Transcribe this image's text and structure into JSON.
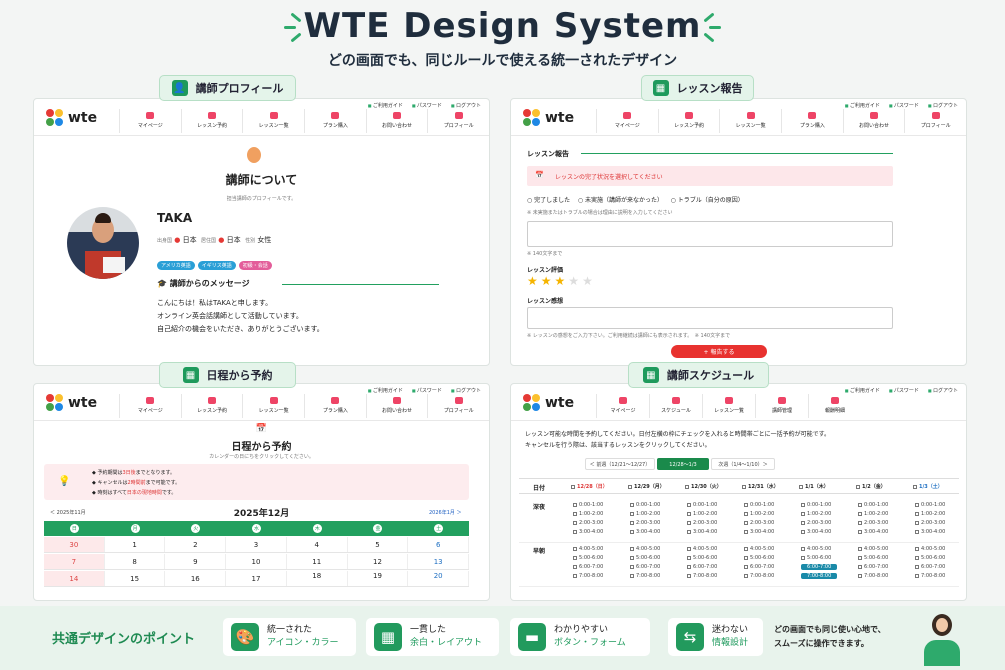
{
  "hero": {
    "title": "WTE Design System",
    "subtitle": "どの画面でも、同じルールで使える統一されたデザイン"
  },
  "sections": {
    "profile": "講師プロフィール",
    "report": "レッスン報告",
    "booking": "日程から予約",
    "schedule": "講師スケジュール"
  },
  "header": {
    "logo": "wte",
    "toplinks": [
      "ご利用ガイド",
      "パスワード",
      "ログアウト"
    ],
    "nav": [
      "マイページ",
      "レッスン予約",
      "レッスン一覧",
      "プラン購入",
      "お問い合わせ",
      "プロフィール"
    ],
    "nav_teacher": [
      "マイページ",
      "スケジュール",
      "レッスン一覧",
      "講師管理",
      "報酬明細"
    ]
  },
  "profile": {
    "heading": "講師について",
    "sub": "担当講師のプロフィールです。",
    "name": "TAKA",
    "fields": {
      "birth_label": "出身国",
      "birth": "日本",
      "home_label": "居住国",
      "home": "日本",
      "sex_label": "性別",
      "sex": "女性"
    },
    "tags": [
      {
        "text": "アメリカ英語",
        "color": "#2a9fd6"
      },
      {
        "text": "イギリス英語",
        "color": "#2a9fd6"
      },
      {
        "text": "初級・会話",
        "color": "#e35d9a"
      }
    ],
    "msg_title": "講師からのメッセージ",
    "msg": [
      "こんにちは！私はTAKAと申します。",
      "オンライン英会話講師として活動しています。",
      "自己紹介の機会をいただき、ありがとうございます。"
    ]
  },
  "report": {
    "title": "レッスン報告",
    "alert": "レッスンの完了状況を選択してください",
    "options": [
      "完了しました",
      "未実施（講師が来なかった）",
      "トラブル（自分の原因）"
    ],
    "note": "※ 未実施またはトラブルの場合は理由に説明を入力してください",
    "count": "※ 140文字まで",
    "rating_label": "レッスン評価",
    "rating": 3,
    "max_rating": 5,
    "comment_label": "レッスン感想",
    "comment_note": "※ レッスンの感想をご入力下さい。ご利用継続は講師にも表示されます。　※ 140文字まで",
    "submit": "+ 報告する"
  },
  "booking": {
    "heading": "日程から予約",
    "sub": "カレンダーの日にちをクリックしてください。",
    "notes": [
      [
        {
          "t": "予約期間は"
        },
        {
          "t": "3日後",
          "r": true
        },
        {
          "t": "までとなります。"
        }
      ],
      [
        {
          "t": "キャンセルは"
        },
        {
          "t": "2時間前",
          "r": true
        },
        {
          "t": "まで可能です。"
        }
      ],
      [
        {
          "t": "時刻はすべて"
        },
        {
          "t": "日本の現地時間",
          "r": true
        },
        {
          "t": "です。"
        }
      ]
    ],
    "prev": "2025年11月",
    "month": "2025年12月",
    "next": "2026年1月",
    "weekdays": [
      "日",
      "月",
      "火",
      "水",
      "木",
      "金",
      "土"
    ],
    "weeks": [
      [
        "30",
        "1",
        "2",
        "3",
        "4",
        "5",
        "6"
      ],
      [
        "7",
        "8",
        "9",
        "10",
        "11",
        "12",
        "13"
      ],
      [
        "14",
        "15",
        "16",
        "17",
        "18",
        "19",
        "20"
      ]
    ]
  },
  "schedule": {
    "intro": [
      "レッスン可能な時間を予約してください。日付左横の枠にチェックを入れると時間帯ごとに一括予約が可能です。",
      "キャンセルを行う際は、該当するレッスンをクリックしてください。"
    ],
    "prev": "＜ 前週（12/21〜12/27）",
    "current": "12/28〜1/3",
    "next": "次週（1/4〜1/10）＞",
    "day_label": "日付",
    "days": [
      "12/28（日）",
      "12/29（月）",
      "12/30（火）",
      "12/31（水）",
      "1/1（木）",
      "1/2（金）",
      "1/3（土）"
    ],
    "groups": [
      {
        "name": "深夜",
        "slots": [
          "0:00-1:00",
          "1:00-2:00",
          "2:00-3:00",
          "3:00-4:00"
        ]
      },
      {
        "name": "早朝",
        "slots": [
          "4:00-5:00",
          "5:00-6:00",
          "6:00-7:00",
          "7:00-8:00"
        ]
      }
    ],
    "booked": [
      "6:00-7:00",
      "7:00-8:00"
    ]
  },
  "points": {
    "title": "共通デザインのポイント",
    "items": [
      {
        "a": "統一された",
        "b": "アイコン・カラー",
        "icon": "🎨"
      },
      {
        "a": "一貫した",
        "b": "余白・レイアウト",
        "icon": "▦"
      },
      {
        "a": "わかりやすい",
        "b": "ボタン・フォーム",
        "icon": "▬"
      },
      {
        "a": "迷わない",
        "b": "情報設計",
        "icon": "⇆"
      }
    ],
    "closing": [
      "どの画面でも同じ使い心地で、",
      "スムーズに操作できます。"
    ]
  }
}
